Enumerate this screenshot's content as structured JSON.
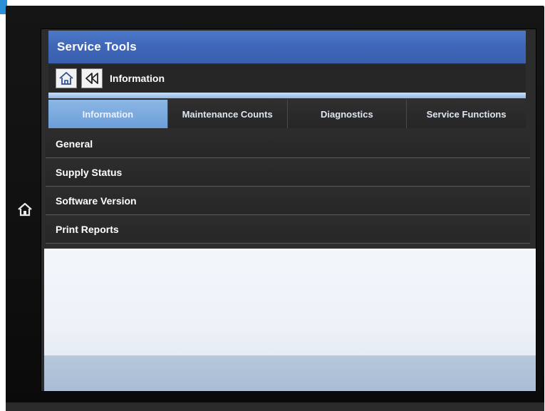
{
  "screen": {
    "title": "Service Tools",
    "breadcrumb": {
      "home_icon": "home-icon",
      "back_icon": "rewind-icon",
      "current": "Information"
    },
    "tabs": [
      {
        "label": "Information",
        "active": true
      },
      {
        "label": "Maintenance Counts",
        "active": false
      },
      {
        "label": "Diagnostics",
        "active": false
      },
      {
        "label": "Service Functions",
        "active": false
      }
    ],
    "items": [
      {
        "label": "General"
      },
      {
        "label": "Supply Status"
      },
      {
        "label": "Software Version"
      },
      {
        "label": "Print Reports"
      }
    ]
  },
  "hardware": {
    "home_key_icon": "home-icon"
  },
  "colors": {
    "title_bar": "#3e66b8",
    "active_tab": "#7aa8dd",
    "list_bg": "#2a2a2a"
  }
}
